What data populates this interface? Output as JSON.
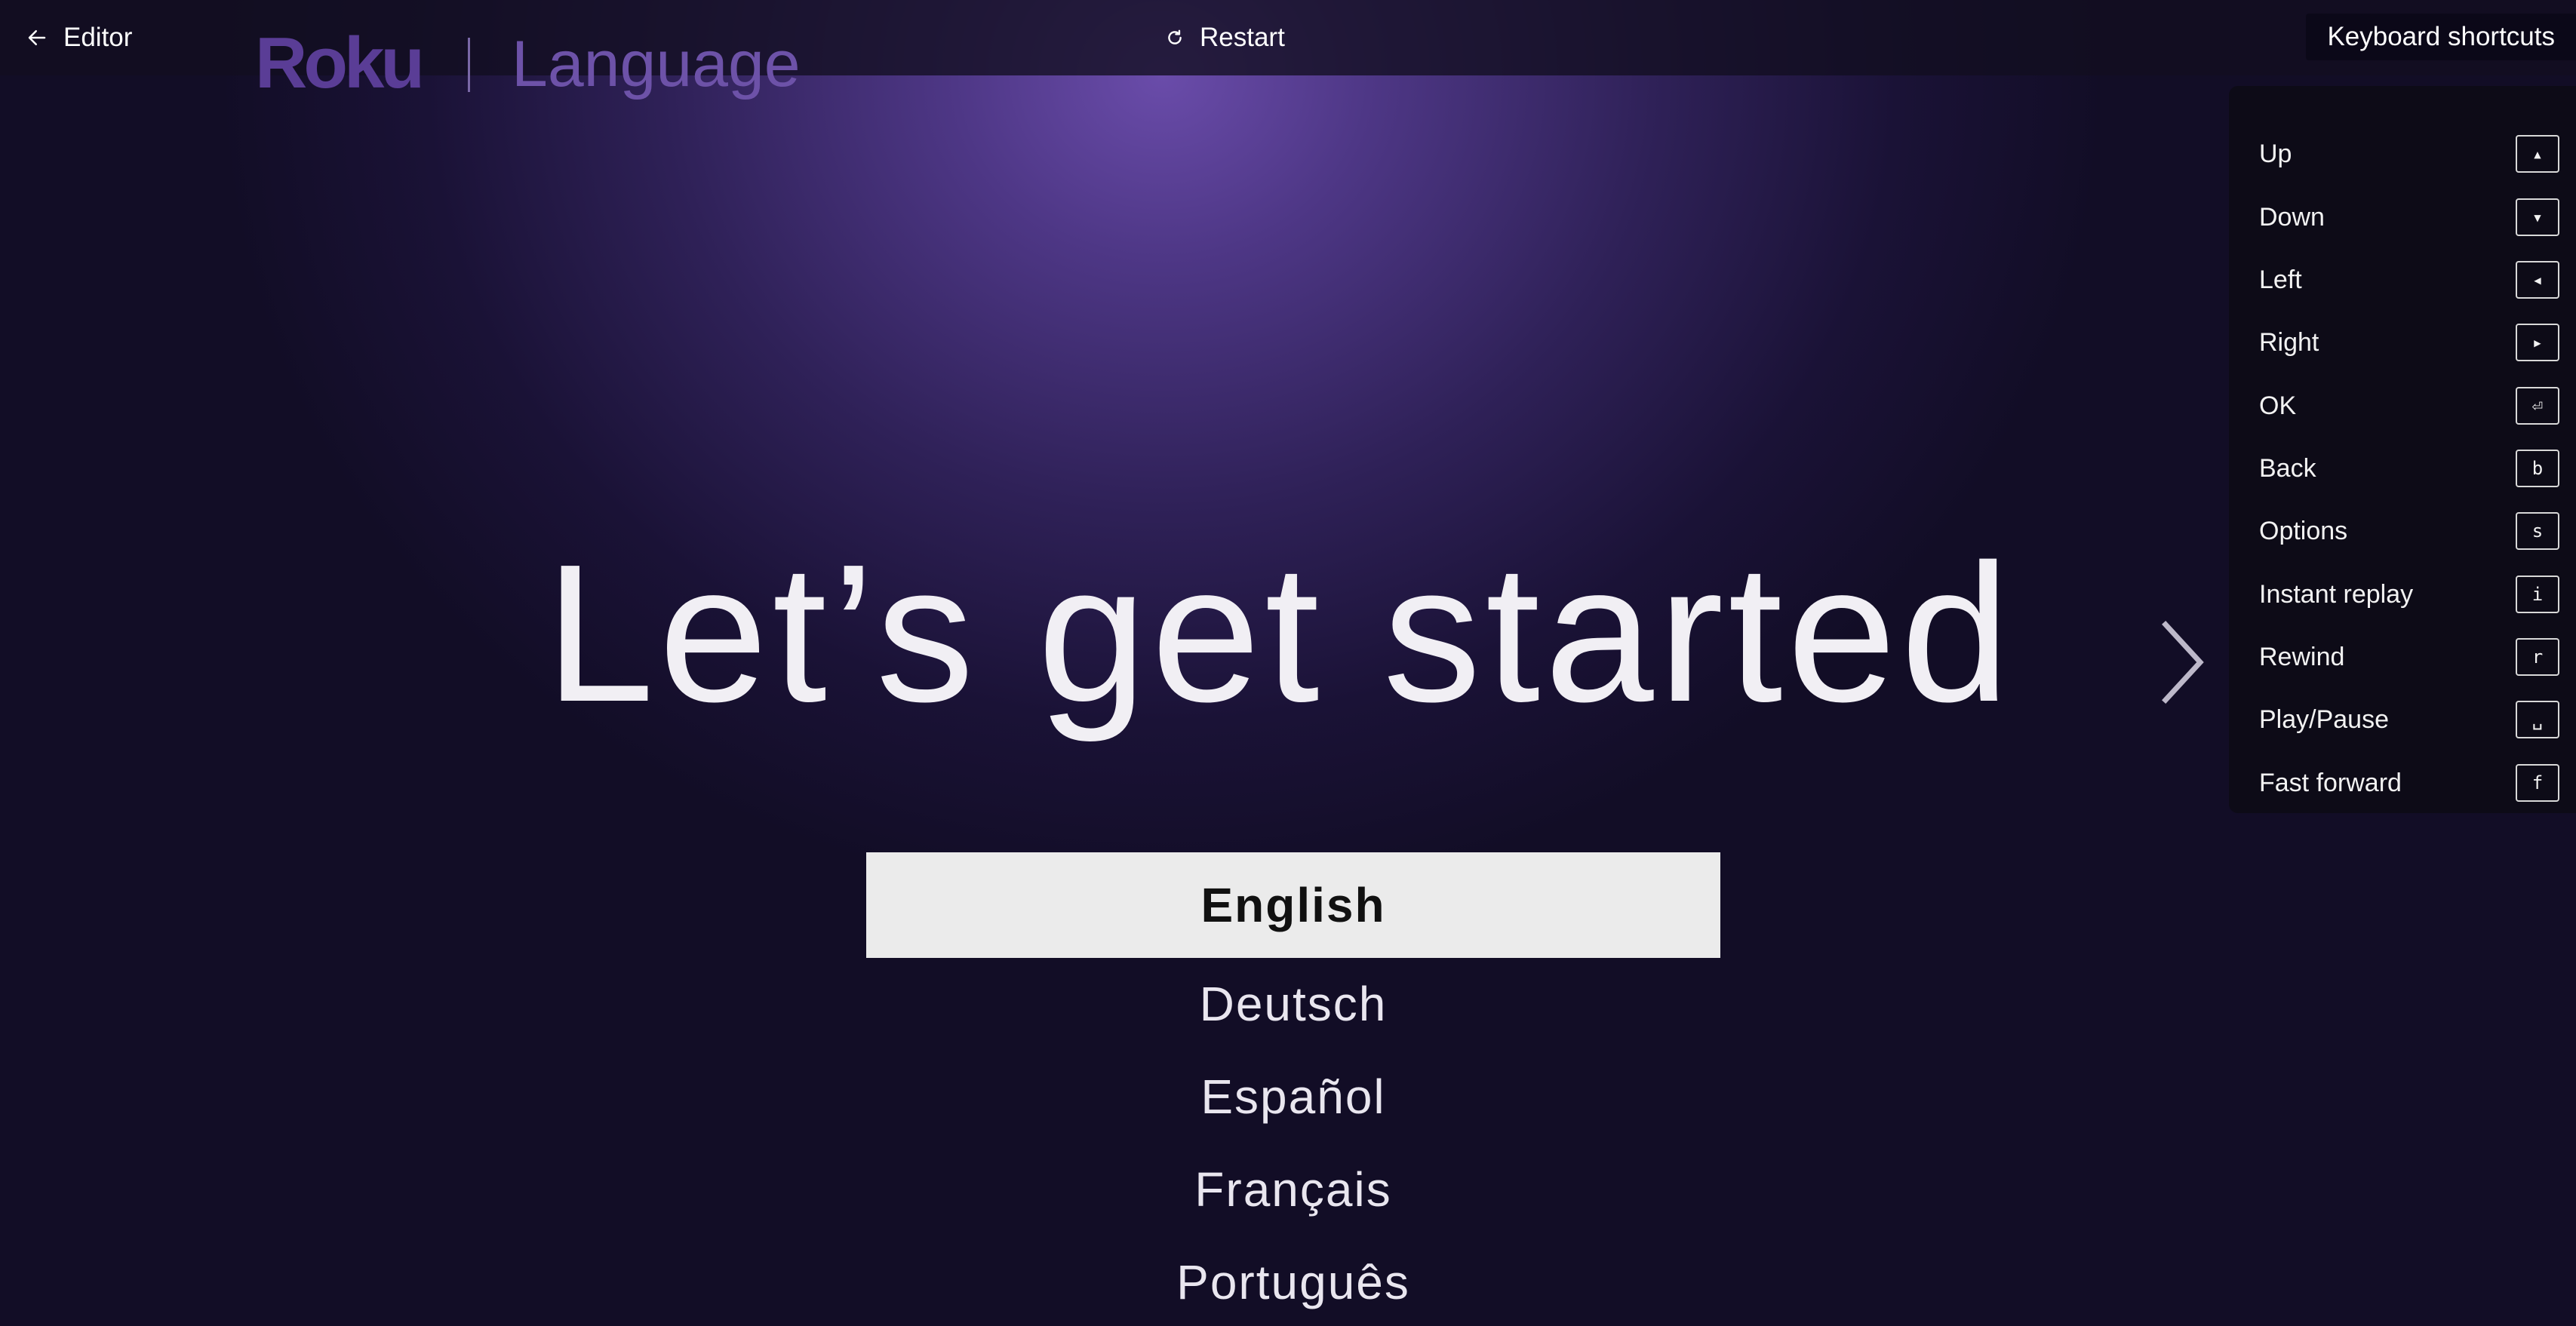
{
  "topbar": {
    "editor_label": "Editor",
    "restart_label": "Restart",
    "shortcuts_label": "Keyboard shortcuts"
  },
  "header": {
    "logo": "Roku",
    "section": "Language"
  },
  "main": {
    "headline": "Let’s get started",
    "languages": [
      {
        "label": "English",
        "selected": true
      },
      {
        "label": "Deutsch",
        "selected": false
      },
      {
        "label": "Español",
        "selected": false
      },
      {
        "label": "Français",
        "selected": false
      },
      {
        "label": "Português",
        "selected": false
      }
    ]
  },
  "shortcuts": [
    {
      "label": "Up",
      "key": "▴"
    },
    {
      "label": "Down",
      "key": "▾"
    },
    {
      "label": "Left",
      "key": "◂"
    },
    {
      "label": "Right",
      "key": "▸"
    },
    {
      "label": "OK",
      "key": "⏎"
    },
    {
      "label": "Back",
      "key": "b"
    },
    {
      "label": "Options",
      "key": "s"
    },
    {
      "label": "Instant replay",
      "key": "i"
    },
    {
      "label": "Rewind",
      "key": "r"
    },
    {
      "label": "Play/Pause",
      "key": "␣"
    },
    {
      "label": "Fast forward",
      "key": "f"
    }
  ],
  "colors": {
    "brand": "#5a3d96",
    "background_glow": "#6a4caa",
    "selected_bg": "#ebebeb"
  }
}
